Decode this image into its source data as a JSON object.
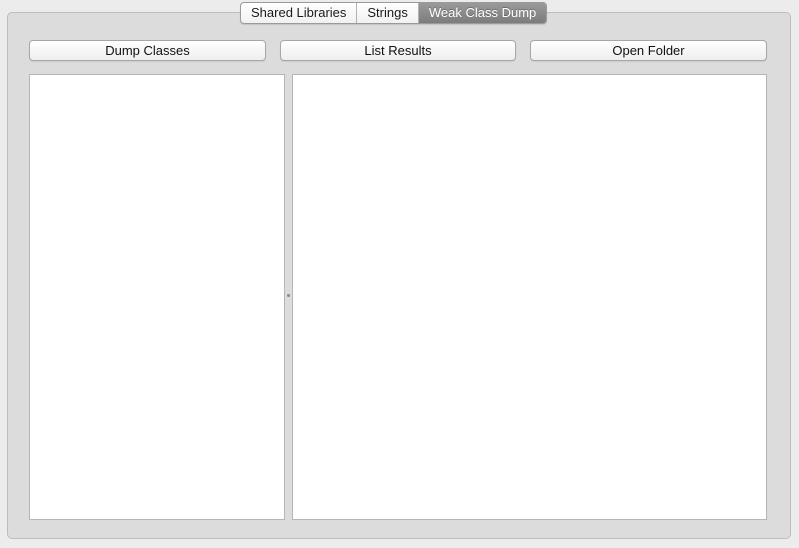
{
  "tabs": [
    {
      "label": "Shared Libraries",
      "active": false
    },
    {
      "label": "Strings",
      "active": false
    },
    {
      "label": "Weak Class Dump",
      "active": true
    }
  ],
  "toolbar": {
    "dump_classes_label": "Dump Classes",
    "list_results_label": "List Results",
    "open_folder_label": "Open Folder"
  },
  "colors": {
    "panel_background": "#dcdcdc",
    "window_background": "#ececec",
    "active_tab": "#8a8a8a",
    "pane_background": "#ffffff"
  }
}
